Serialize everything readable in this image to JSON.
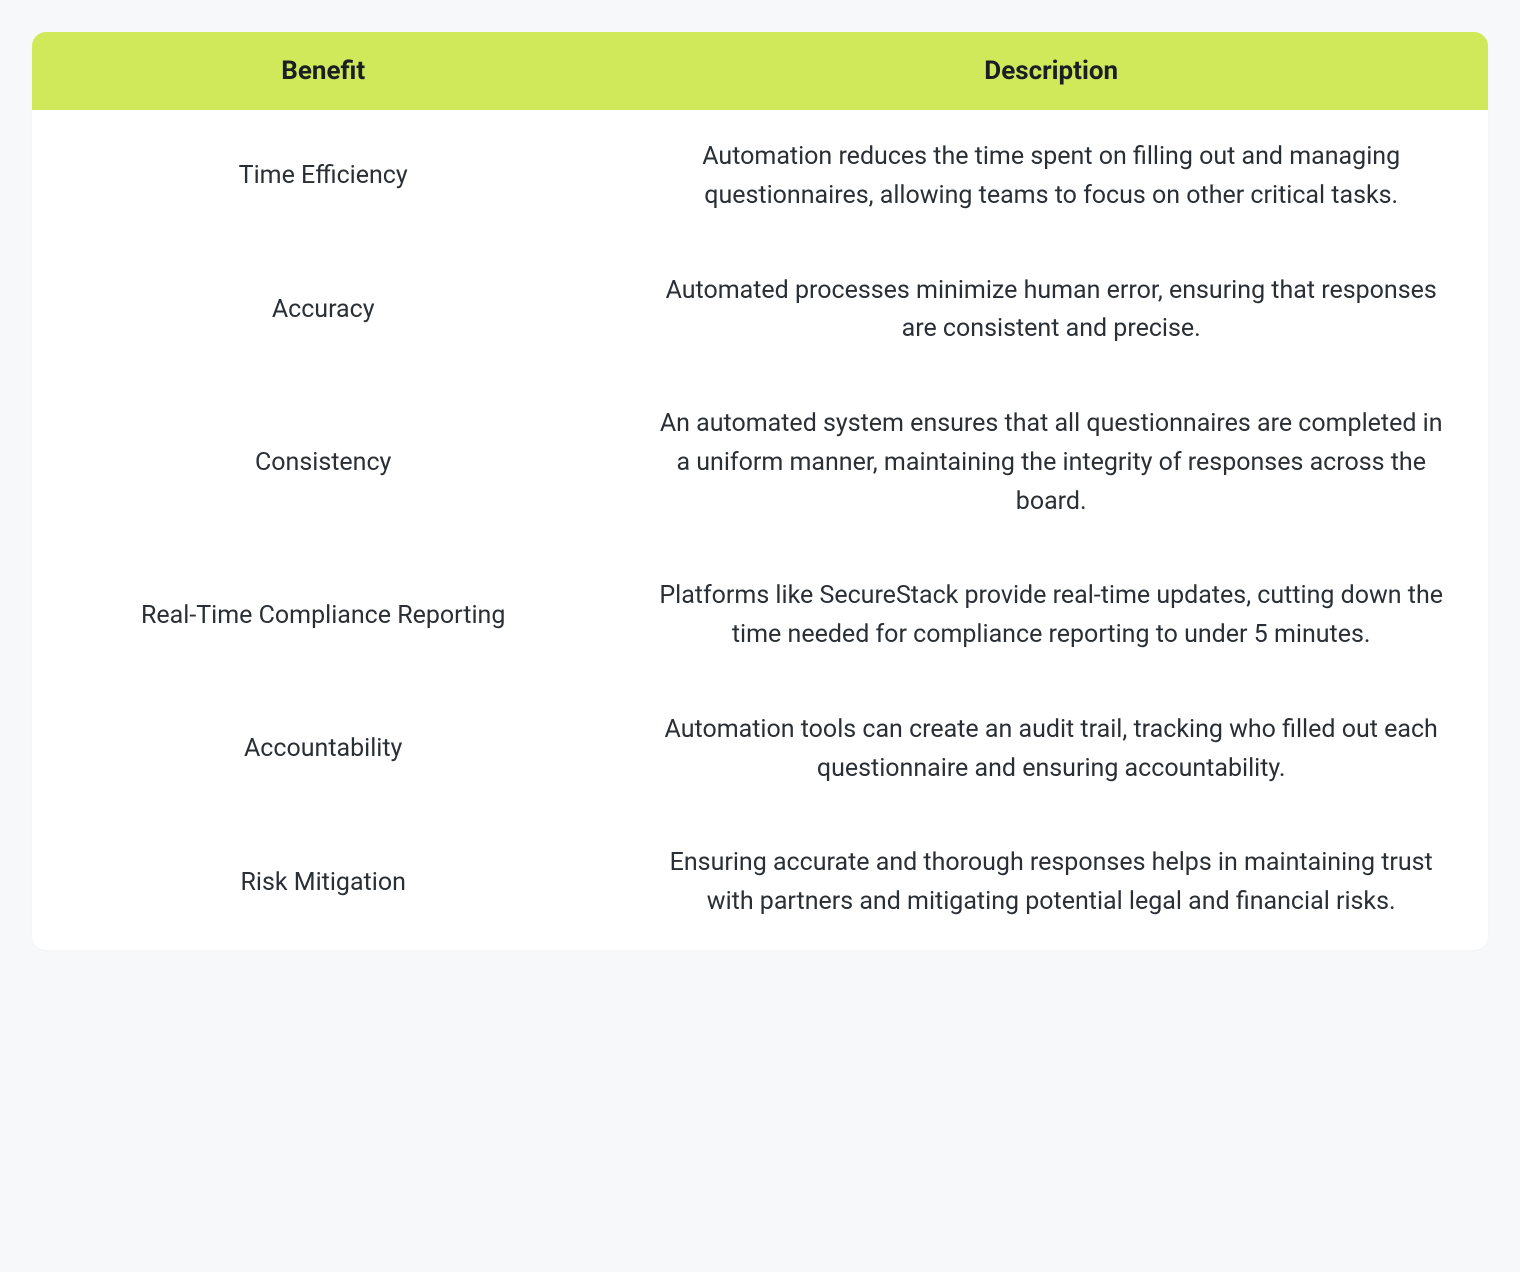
{
  "table": {
    "headers": {
      "benefit": "Benefit",
      "description": "Description"
    },
    "rows": [
      {
        "benefit": "Time Efficiency",
        "description": "Automation reduces the time spent on filling out and managing questionnaires, allowing teams to focus on other critical tasks."
      },
      {
        "benefit": "Accuracy",
        "description": "Automated processes minimize human error, ensuring that responses are consistent and precise."
      },
      {
        "benefit": "Consistency",
        "description": "An automated system ensures that all questionnaires are completed in a uniform manner, maintaining the integrity of responses across the board."
      },
      {
        "benefit": "Real-Time Compliance Reporting",
        "description": "Platforms like SecureStack provide real-time updates, cutting down the time needed for compliance reporting to under 5 minutes."
      },
      {
        "benefit": "Accountability",
        "description": "Automation tools can create an audit trail, tracking who filled out each questionnaire and ensuring accountability."
      },
      {
        "benefit": "Risk Mitigation",
        "description": "Ensuring accurate and thorough responses helps in maintaining trust with partners and mitigating potential legal and financial risks."
      }
    ]
  }
}
